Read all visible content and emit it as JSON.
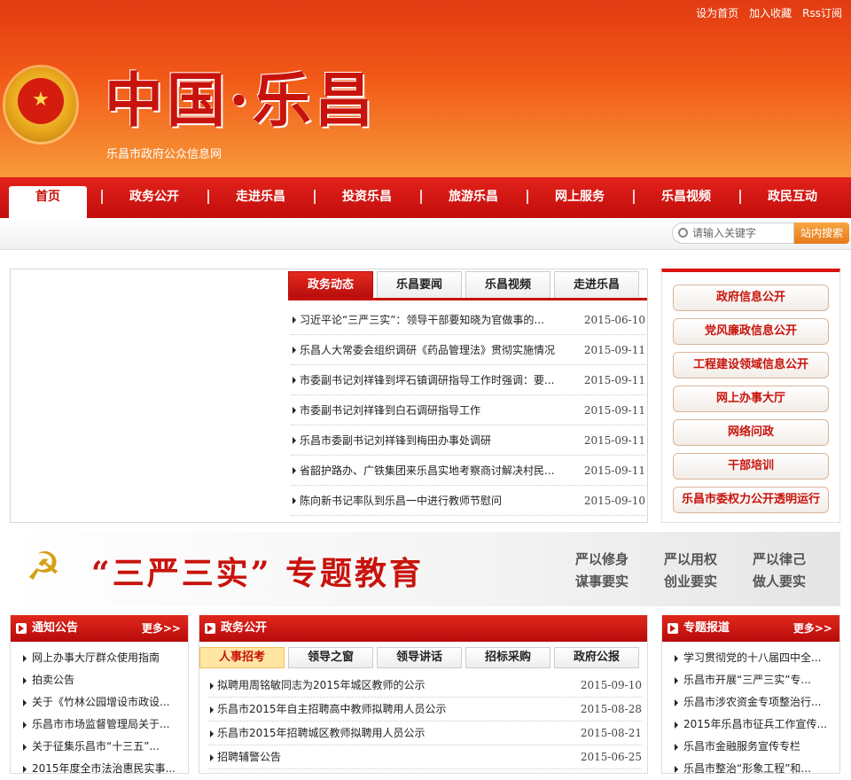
{
  "toplinks": [
    "设为首页",
    "加入收藏",
    "Rss订阅"
  ],
  "header": {
    "calligraphy": "中国·乐昌",
    "sitename": "乐昌市政府公众信息网"
  },
  "nav": [
    "首页",
    "政务公开",
    "走进乐昌",
    "投资乐昌",
    "旅游乐昌",
    "网上服务",
    "乐昌视频",
    "政民互动"
  ],
  "search": {
    "placeholder": "请输入关键字",
    "button": "站内搜索"
  },
  "news": {
    "tabs": [
      "政务动态",
      "乐昌要闻",
      "乐昌视频",
      "走进乐昌"
    ],
    "items": [
      {
        "title": "习近平论“三严三实”：领导干部要知晓为官做事的...",
        "date": "2015-06-10"
      },
      {
        "title": "乐昌人大常委会组织调研《药品管理法》贯彻实施情况",
        "date": "2015-09-11"
      },
      {
        "title": "市委副书记刘祥锋到坪石镇调研指导工作时强调：要...",
        "date": "2015-09-11"
      },
      {
        "title": "市委副书记刘祥锋到白石调研指导工作",
        "date": "2015-09-11"
      },
      {
        "title": "乐昌市委副书记刘祥锋到梅田办事处调研",
        "date": "2015-09-11"
      },
      {
        "title": "省韶护路办、广铁集团来乐昌实地考察商讨解决村民...",
        "date": "2015-09-11"
      },
      {
        "title": "陈向新书记率队到乐昌一中进行教师节慰问",
        "date": "2015-09-10"
      }
    ]
  },
  "quicklinks": [
    "政府信息公开",
    "党风廉政信息公开",
    "工程建设领域信息公开",
    "网上办事大厅",
    "网络问政",
    "干部培训",
    "乐昌市委权力公开透明运行"
  ],
  "banner": {
    "title": "“三严三实” 专题教育",
    "slogans": [
      "严以修身",
      "严以用权",
      "严以律己",
      "谋事要实",
      "创业要实",
      "做人要实"
    ]
  },
  "notice": {
    "title": "通知公告",
    "more": "更多>>",
    "items": [
      "网上办事大厅群众使用指南",
      "拍卖公告",
      "关于《竹林公园增设市政设...",
      "乐昌市市场监督管理局关于...",
      "关于征集乐昌市“十三五”...",
      "2015年度全市法治惠民实事..."
    ]
  },
  "gov": {
    "title": "政务公开",
    "tabs": [
      "人事招考",
      "领导之窗",
      "领导讲话",
      "招标采购",
      "政府公报"
    ],
    "items": [
      {
        "title": "拟聘用周铭敏同志为2015年城区教师的公示",
        "date": "2015-09-10"
      },
      {
        "title": "乐昌市2015年自主招聘高中教师拟聘用人员公示",
        "date": "2015-08-28"
      },
      {
        "title": "乐昌市2015年招聘城区教师拟聘用人员公示",
        "date": "2015-08-21"
      },
      {
        "title": "招聘辅警公告",
        "date": "2015-06-25"
      }
    ]
  },
  "special": {
    "title": "专题报道",
    "more": "更多>>",
    "items": [
      "学习贯彻党的十八届四中全...",
      "乐昌市开展“三严三实”专...",
      "乐昌市涉农资金专项整治行...",
      "2015年乐昌市征兵工作宣传...",
      "乐昌市金融服务宣传专栏",
      "乐昌市整治“形象工程”和..."
    ]
  }
}
